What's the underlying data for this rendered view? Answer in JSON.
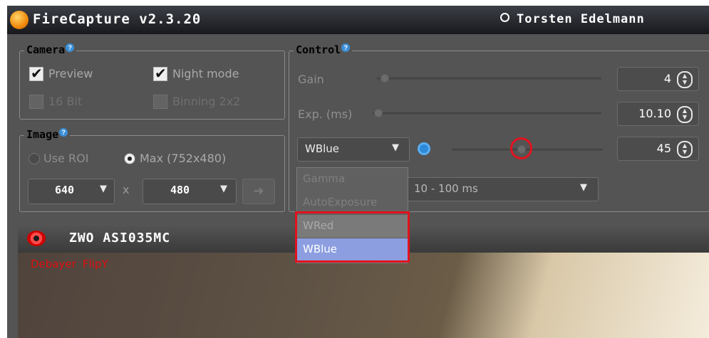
{
  "app": {
    "title": "FireCapture v2.3.20",
    "author": "Torsten Edelmann"
  },
  "camera_group": {
    "title": "Camera",
    "preview": "Preview",
    "night_mode": "Night mode",
    "bit16": "16 Bit",
    "binning": "Binning 2x2"
  },
  "image_group": {
    "title": "Image",
    "use_roi": "Use ROI",
    "max": "Max (752x480)",
    "width": "640",
    "x_sep": "x",
    "height": "480"
  },
  "control_group": {
    "title": "Control",
    "gain": {
      "label": "Gain",
      "value": "4"
    },
    "exposure": {
      "label": "Exp. (ms)",
      "value": "10.10"
    },
    "param": {
      "selected": "WBlue",
      "value": "45"
    },
    "exposure_range": "10 - 100 ms"
  },
  "dropdown": {
    "options": [
      "Gamma",
      "AutoExposure",
      "WRed",
      "WBlue"
    ]
  },
  "camera_view": {
    "name": "ZWO ASI035MC",
    "debayer": "Debayer",
    "flip": "FlipY"
  },
  "colors": {
    "titlebar": "#1d1f24",
    "panel": "#545454",
    "highlight": "#e2121e",
    "selected": "#8c9ee0",
    "accent": "#3b8fd8"
  }
}
